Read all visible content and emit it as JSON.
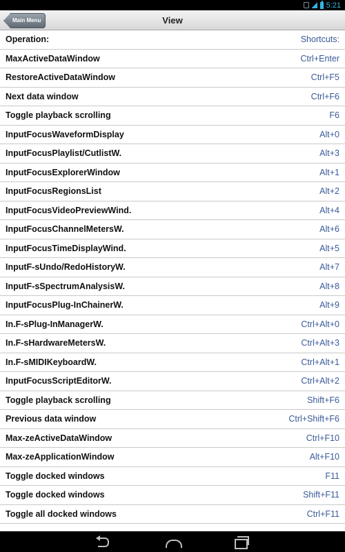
{
  "status_bar": {
    "time": "5:21"
  },
  "nav": {
    "back_label": "Main Menu",
    "title": "View"
  },
  "header": {
    "operation": "Operation:",
    "shortcuts": "Shortcuts:"
  },
  "rows": [
    {
      "op": "MaxActiveDataWindow",
      "sc": "Ctrl+Enter"
    },
    {
      "op": "RestoreActiveDataWindow",
      "sc": "Ctrl+F5"
    },
    {
      "op": "Next data window",
      "sc": "Ctrl+F6"
    },
    {
      "op": "Toggle playback scrolling",
      "sc": "F6"
    },
    {
      "op": "InputFocusWaveformDisplay",
      "sc": "Alt+0"
    },
    {
      "op": "InputFocusPlaylist/CutlistW.",
      "sc": "Alt+3"
    },
    {
      "op": "InputFocusExplorerWindow",
      "sc": "Alt+1"
    },
    {
      "op": "InputFocusRegionsList",
      "sc": "Alt+2"
    },
    {
      "op": "InputFocusVideoPreviewWind.",
      "sc": "Alt+4"
    },
    {
      "op": "InputFocusChannelMetersW.",
      "sc": "Alt+6"
    },
    {
      "op": "InputFocusTimeDisplayWind.",
      "sc": "Alt+5"
    },
    {
      "op": "InputF-sUndo/RedoHistoryW.",
      "sc": "Alt+7"
    },
    {
      "op": "InputF-sSpectrumAnalysisW.",
      "sc": "Alt+8"
    },
    {
      "op": "InputFocusPlug-InChainerW.",
      "sc": "Alt+9"
    },
    {
      "op": "In.F-sPlug-InManagerW.",
      "sc": "Ctrl+Alt+0"
    },
    {
      "op": "In.F-sHardwareMetersW.",
      "sc": "Ctrl+Alt+3"
    },
    {
      "op": "In.F-sMIDIKeyboardW.",
      "sc": "Ctrl+Alt+1"
    },
    {
      "op": "InputFocusScriptEditorW.",
      "sc": "Ctrl+Alt+2"
    },
    {
      "op": "Toggle playback scrolling",
      "sc": "Shift+F6"
    },
    {
      "op": "Previous data window",
      "sc": "Ctrl+Shift+F6"
    },
    {
      "op": "Max-zeActiveDataWindow",
      "sc": "Ctrl+F10"
    },
    {
      "op": "Max-zeApplicationWindow",
      "sc": "Alt+F10"
    },
    {
      "op": "Toggle docked windows",
      "sc": "F11"
    },
    {
      "op": "Toggle docked windows",
      "sc": "Shift+F11"
    },
    {
      "op": "Toggle all docked windows",
      "sc": "Ctrl+F11"
    }
  ],
  "system_nav": {
    "back_icon": "back-icon",
    "home_icon": "home-icon",
    "recents_icon": "recents-icon"
  },
  "colors": {
    "shortcut_text": "#3a5a98",
    "status_accent": "#33b5e5"
  }
}
